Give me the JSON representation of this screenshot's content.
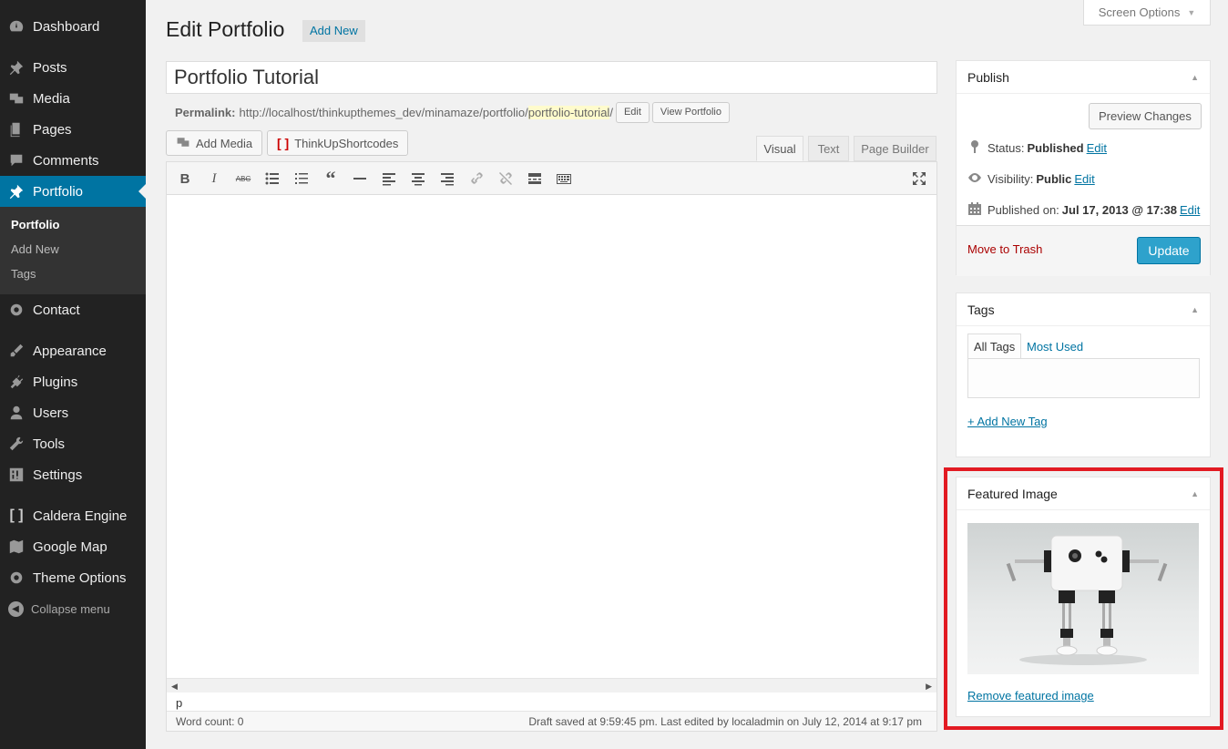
{
  "sidebar": {
    "items": [
      {
        "label": "Dashboard",
        "icon": "dashboard-icon"
      },
      {
        "label": "Posts",
        "icon": "pin-icon"
      },
      {
        "label": "Media",
        "icon": "media-icon"
      },
      {
        "label": "Pages",
        "icon": "pages-icon"
      },
      {
        "label": "Comments",
        "icon": "comment-icon"
      },
      {
        "label": "Portfolio",
        "icon": "pin-icon"
      },
      {
        "label": "Contact",
        "icon": "gear-icon"
      },
      {
        "label": "Appearance",
        "icon": "brush-icon"
      },
      {
        "label": "Plugins",
        "icon": "plug-icon"
      },
      {
        "label": "Users",
        "icon": "user-icon"
      },
      {
        "label": "Tools",
        "icon": "wrench-icon"
      },
      {
        "label": "Settings",
        "icon": "settings-icon"
      },
      {
        "label": "Caldera Engine",
        "icon": "bracket-icon"
      },
      {
        "label": "Google Map",
        "icon": "map-icon"
      },
      {
        "label": "Theme Options",
        "icon": "gear-icon"
      }
    ],
    "submenu": [
      "Portfolio",
      "Add New",
      "Tags"
    ],
    "collapse_label": "Collapse menu"
  },
  "header": {
    "title": "Edit Portfolio",
    "add_new": "Add New",
    "screen_options": "Screen Options"
  },
  "post": {
    "title": "Portfolio Tutorial",
    "permalink_label": "Permalink:",
    "permalink_base": "http://localhost/thinkupthemes_dev/minamaze/portfolio/",
    "permalink_slug": "portfolio-tutorial",
    "permalink_end": "/",
    "edit_btn": "Edit",
    "view_btn": "View Portfolio"
  },
  "editor": {
    "add_media": "Add Media",
    "shortcodes": "ThinkUpShortcodes",
    "tabs": [
      "Visual",
      "Text",
      "Page Builder"
    ],
    "path": "p",
    "word_count": "Word count: 0",
    "draft_status": "Draft saved at 9:59:45 pm. Last edited by localadmin on July 12, 2014 at 9:17 pm"
  },
  "publish": {
    "title": "Publish",
    "preview": "Preview Changes",
    "status_label": "Status:",
    "status_value": "Published",
    "visibility_label": "Visibility:",
    "visibility_value": "Public",
    "published_label": "Published on:",
    "published_value": "Jul 17, 2013 @ 17:38",
    "edit": "Edit",
    "trash": "Move to Trash",
    "update": "Update"
  },
  "tags": {
    "title": "Tags",
    "tab_all": "All Tags",
    "tab_used": "Most Used",
    "add_link": "+ Add New Tag"
  },
  "featured": {
    "title": "Featured Image",
    "remove": "Remove featured image"
  }
}
